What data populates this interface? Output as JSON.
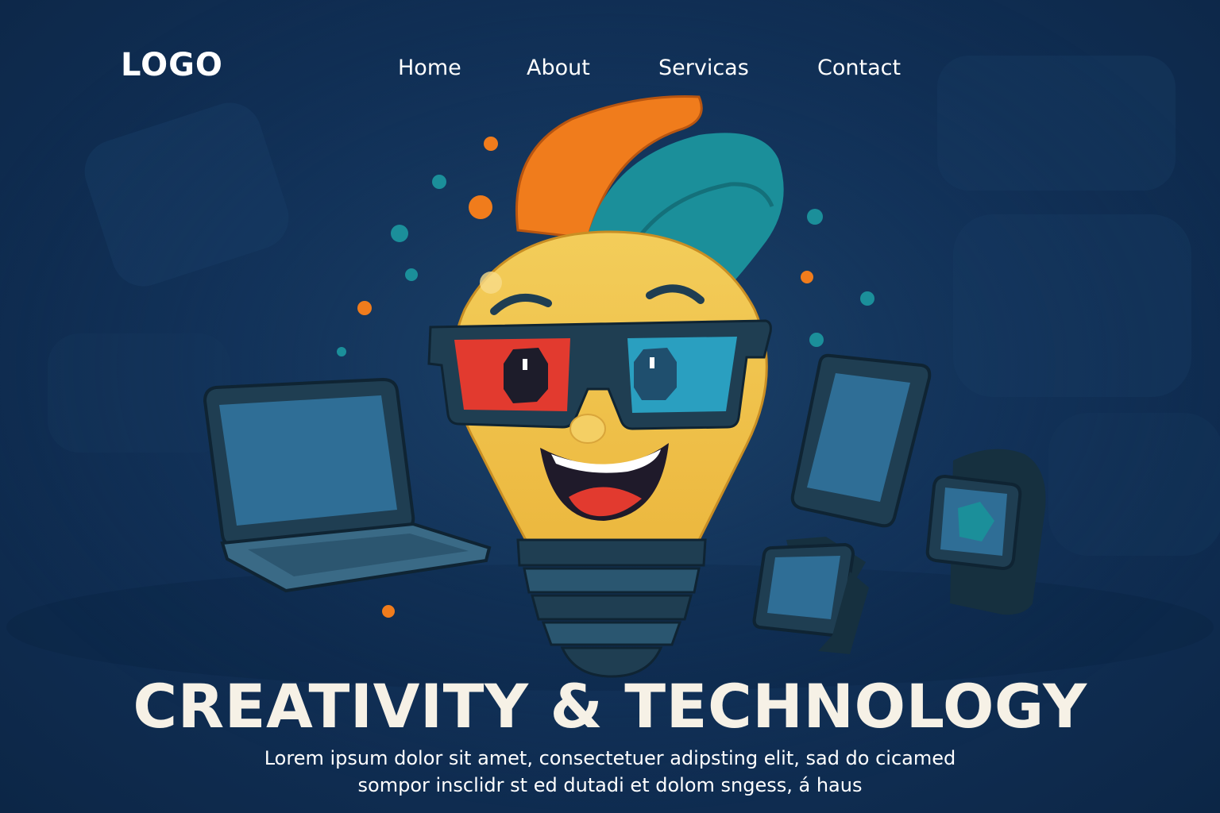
{
  "brand": {
    "logo_text": "LOGO"
  },
  "nav": {
    "items": [
      {
        "label": "Home"
      },
      {
        "label": "About"
      },
      {
        "label": "Servicas"
      },
      {
        "label": "Contact"
      }
    ]
  },
  "hero": {
    "title": "CREATIVITY & TECHNOLOGY",
    "subtitle_line1": "Lorem ipsum dolor sit amet, consectetuer adipsting elit, sad do cicamed",
    "subtitle_line2": "sompor insclidr st ed dutadi et dolom sngess, á haus"
  },
  "illustration": {
    "icons": [
      "lightbulb-mascot-icon",
      "3d-glasses-icon",
      "laptop-icon",
      "smartphone-icon",
      "smartwatch-icon"
    ]
  },
  "colors": {
    "background": "#12325a",
    "bulb": "#f2c64e",
    "orange_accent": "#f07c1c",
    "teal_accent": "#1b8f9a",
    "lens_red": "#e23a2f",
    "lens_blue": "#2a9fc0",
    "device_frame": "#1f3e52",
    "device_screen": "#2f6e96",
    "text": "#ffffff"
  }
}
